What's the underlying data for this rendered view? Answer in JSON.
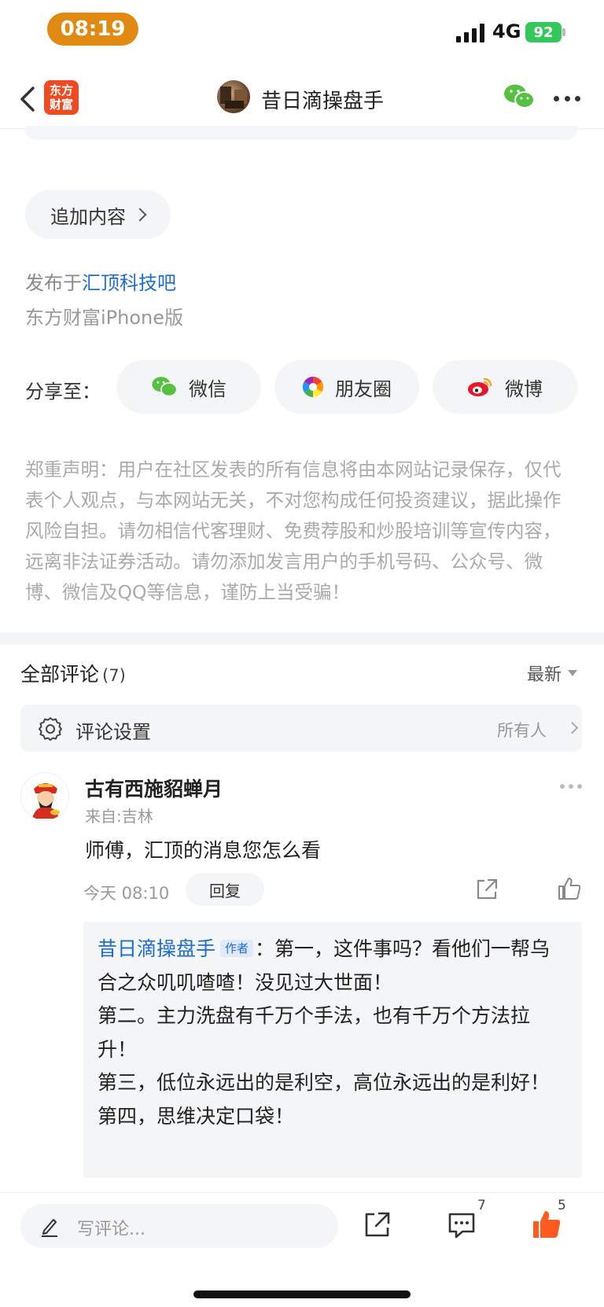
{
  "status_bar": {
    "time": "08:19",
    "network": "4G",
    "battery": "92"
  },
  "nav": {
    "logo_line1": "东方",
    "logo_line2": "财富",
    "title": "昔日滴操盘手"
  },
  "post": {
    "add_content_label": "追加内容",
    "published_prefix": "发布于",
    "bar_name": "汇顶科技吧",
    "source": "东方财富iPhone版"
  },
  "share": {
    "label": "分享至：",
    "wechat": "微信",
    "moments": "朋友圈",
    "weibo": "微博"
  },
  "disclaimer": "郑重声明：用户在社区发表的所有信息将由本网站记录保存，仅代表个人观点，与本网站无关，不对您构成任何投资建议，据此操作风险自担。请勿相信代客理财、免费荐股和炒股培训等宣传内容，远离非法证券活动。请勿添加发言用户的手机号码、公众号、微博、微信及QQ等信息，谨防上当受骗！",
  "comments": {
    "title": "全部评论",
    "count": "(7)",
    "sort": "最新",
    "settings_label": "评论设置",
    "settings_value": "所有人",
    "items": [
      {
        "name": "古有西施貂蝉月",
        "location": "来自:吉林",
        "text": "师傅，汇顶的消息您怎么看",
        "time": "今天 08:10",
        "reply_label": "回复",
        "reply": {
          "author": "昔日滴操盘手",
          "badge": "作者",
          "sep": "：",
          "text": "第一，这件事吗？看他们一帮乌合之众叽叽喳喳！没见过大世面！",
          "line2": "第二。主力洗盘有千万个手法，也有千万个方法拉升！",
          "line3": "第三，低位永远出的是利空，高位永远出的是利好！",
          "line4": "第四，思维决定口袋！"
        }
      }
    ]
  },
  "bottom_bar": {
    "placeholder": "写评论...",
    "comment_count": "7",
    "like_count": "5"
  },
  "colors": {
    "accent_orange": "#ff5a1f",
    "link_blue": "#1c6fd1",
    "time_pill": "#e08a12",
    "battery": "#34c759"
  }
}
